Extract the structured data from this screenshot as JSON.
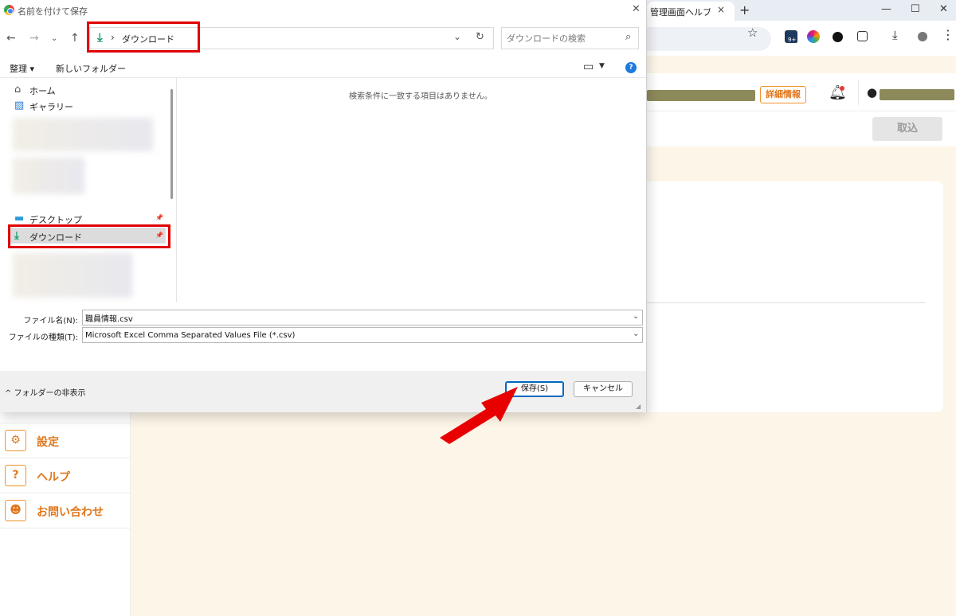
{
  "browser": {
    "tab_title": "管理画面ヘルプ | サ",
    "tab_close": "×",
    "new_tab": "+",
    "window_controls": [
      "—",
      "☐",
      "✕"
    ],
    "extension_badge": "9+",
    "detail_button": "詳細情報",
    "import_button": "取込",
    "sidebar": [
      {
        "icon": "gear-icon",
        "glyph": "⚙",
        "label": "設定"
      },
      {
        "icon": "help-circle-icon",
        "glyph": "?",
        "label": "ヘルプ"
      },
      {
        "icon": "support-person-icon",
        "glyph": "☻",
        "label": "お問い合わせ"
      }
    ]
  },
  "dialog": {
    "title": "名前を付けて保存",
    "close": "✕",
    "address": {
      "separator": "›",
      "location": "ダウンロード"
    },
    "search_placeholder": "ダウンロードの検索",
    "commands": {
      "organize": "整理 ▾",
      "new_folder": "新しいフォルダー"
    },
    "nav_items": [
      {
        "icon": "home-icon",
        "glyph": "⌂",
        "label": "ホーム"
      },
      {
        "icon": "gallery-icon",
        "glyph": "▨",
        "label": "ギャラリー"
      },
      {
        "icon": "desktop-icon",
        "glyph": "▬",
        "label": "デスクトップ",
        "pin": "📌"
      },
      {
        "icon": "download-icon",
        "glyph": "⤓",
        "label": "ダウンロード",
        "pin": "📌",
        "selected": true
      }
    ],
    "empty_message": "検索条件に一致する項目はありません。",
    "file_name_label": "ファイル名(N):",
    "file_name_value": "職員情報.csv",
    "file_type_label": "ファイルの種類(T):",
    "file_type_value": "Microsoft Excel Comma Separated Values File (*.csv)",
    "hide_folders": "^ フォルダーの非表示",
    "save_button": "保存(S)",
    "cancel_button": "キャンセル"
  },
  "colors": {
    "accent_orange": "#f0922b",
    "highlight_red": "#e00000",
    "download_green": "#1a9d74"
  }
}
